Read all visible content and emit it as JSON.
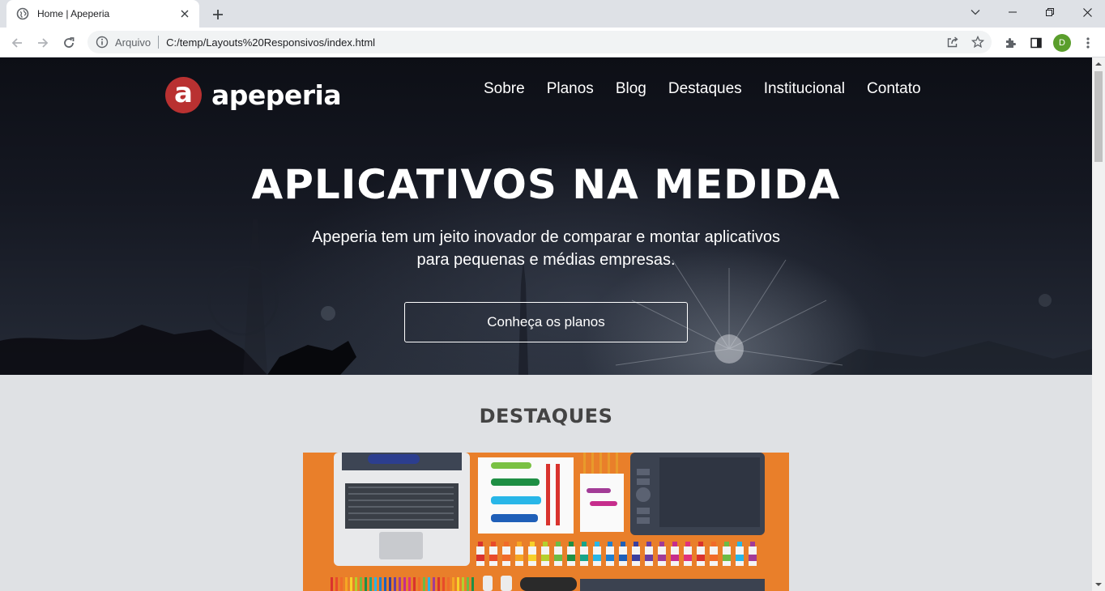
{
  "browser": {
    "tab_title": "Home | Apeperia",
    "address_scheme": "Arquivo",
    "address_url": "C:/temp/Layouts%20Responsivos/index.html",
    "profile_initial": "D",
    "profile_color": "#5a9e2c"
  },
  "site": {
    "logo_letter": "a",
    "logo_text": "apeperia",
    "brand_color": "#b93131",
    "nav": [
      {
        "label": "Sobre"
      },
      {
        "label": "Planos"
      },
      {
        "label": "Blog"
      },
      {
        "label": "Destaques"
      },
      {
        "label": "Institucional"
      },
      {
        "label": "Contato"
      }
    ],
    "hero": {
      "title": "APLICATIVOS NA MEDIDA",
      "subtitle": "Apeperia tem um jeito inovador de comparar e montar aplicativos para pequenas e médias empresas.",
      "cta_label": "Conheça os planos"
    },
    "highlights": {
      "title": "DESTAQUES",
      "image_bg": "#e97f2a"
    }
  }
}
